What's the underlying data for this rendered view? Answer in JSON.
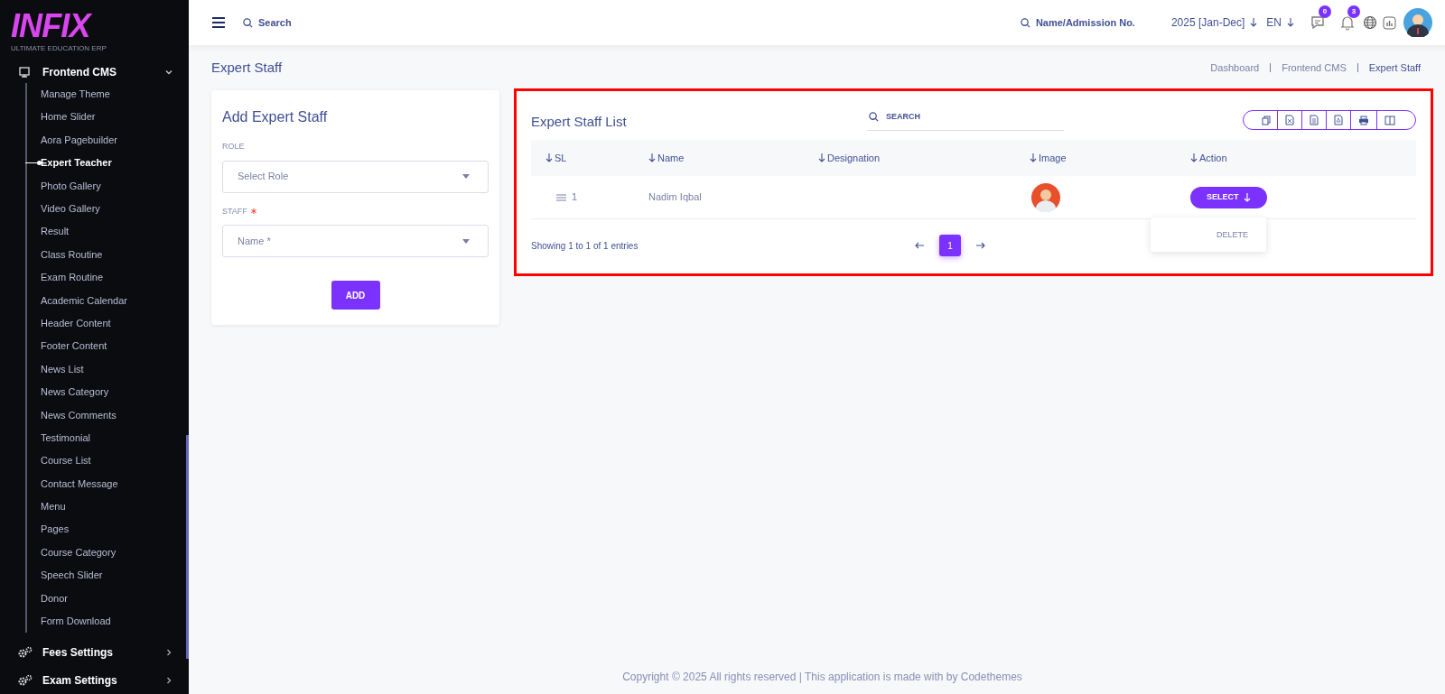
{
  "logo": {
    "text": "INFIX",
    "subtitle": "ULTIMATE EDUCATION ERP"
  },
  "sidebar": {
    "section": {
      "label": "Frontend CMS",
      "expanded": true
    },
    "items": [
      {
        "label": "Manage Theme",
        "selected": false
      },
      {
        "label": "Home Slider",
        "selected": false
      },
      {
        "label": "Aora Pagebuilder",
        "selected": false
      },
      {
        "label": "Expert Teacher",
        "selected": true
      },
      {
        "label": "Photo Gallery",
        "selected": false
      },
      {
        "label": "Video Gallery",
        "selected": false
      },
      {
        "label": "Result",
        "selected": false
      },
      {
        "label": "Class Routine",
        "selected": false
      },
      {
        "label": "Exam Routine",
        "selected": false
      },
      {
        "label": "Academic Calendar",
        "selected": false
      },
      {
        "label": "Header Content",
        "selected": false
      },
      {
        "label": "Footer Content",
        "selected": false
      },
      {
        "label": "News List",
        "selected": false
      },
      {
        "label": "News Category",
        "selected": false
      },
      {
        "label": "News Comments",
        "selected": false
      },
      {
        "label": "Testimonial",
        "selected": false
      },
      {
        "label": "Course List",
        "selected": false
      },
      {
        "label": "Contact Message",
        "selected": false
      },
      {
        "label": "Menu",
        "selected": false
      },
      {
        "label": "Pages",
        "selected": false
      },
      {
        "label": "Course Category",
        "selected": false
      },
      {
        "label": "Speech Slider",
        "selected": false
      },
      {
        "label": "Donor",
        "selected": false
      },
      {
        "label": "Form Download",
        "selected": false
      }
    ],
    "bottom_items": [
      {
        "label": "Fees Settings",
        "expanded": false
      },
      {
        "label": "Exam Settings",
        "expanded": false
      }
    ]
  },
  "topbar": {
    "search": {
      "placeholder": "Search"
    },
    "student_search": {
      "placeholder": "Name/Admission No."
    },
    "session": "2025 [Jan-Dec]",
    "language": "EN",
    "messages_count": "0",
    "notifications_count": "3"
  },
  "page": {
    "title": "Expert Staff",
    "breadcrumbs": [
      "Dashboard",
      "Frontend CMS",
      "Expert Staff"
    ]
  },
  "form": {
    "title": "Add Expert Staff",
    "fields": [
      {
        "label": "ROLE",
        "required": false,
        "placeholder": "Select Role"
      },
      {
        "label": "STAFF",
        "required": true,
        "placeholder": "Name *"
      }
    ],
    "button": "ADD"
  },
  "list": {
    "title": "Expert Staff List",
    "search": {
      "placeholder": "SEARCH"
    },
    "columns": [
      "SL",
      "Name",
      "Designation",
      "Image",
      "Action"
    ],
    "rows": [
      {
        "sl": "1",
        "name": "Nadim Iqbal",
        "action": "SELECT",
        "menu": [
          "DELETE"
        ]
      }
    ],
    "info": "Showing 1 to 1 of 1 entries",
    "pages": [
      {
        "label": "1",
        "selected": true
      }
    ]
  },
  "footer": "Copyright © 2025 All rights reserved | This application is made with by Codethemes"
}
